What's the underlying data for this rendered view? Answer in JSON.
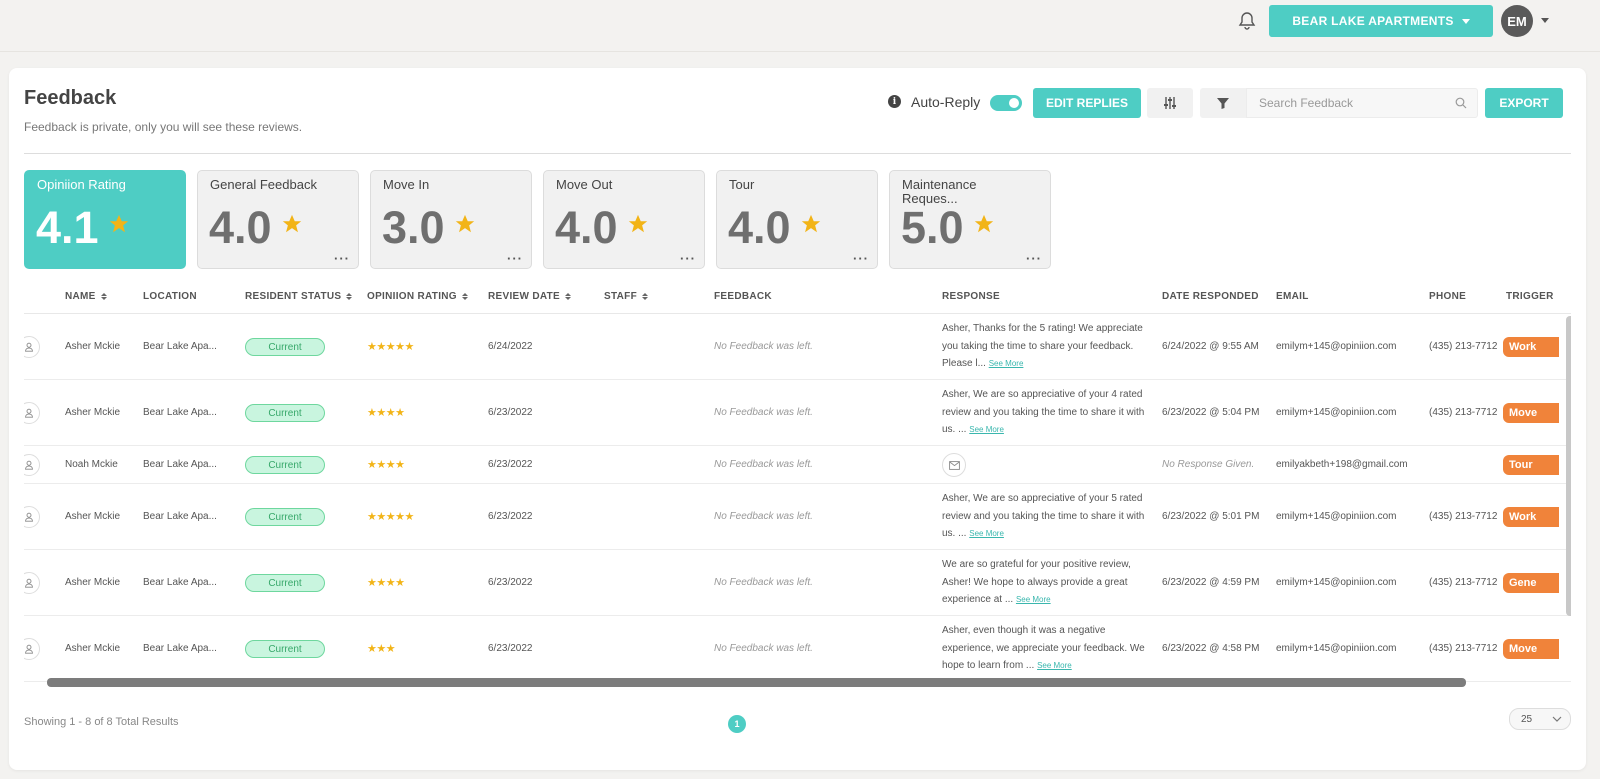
{
  "topbar": {
    "property_label": "BEAR LAKE APARTMENTS",
    "avatar_initials": "EM"
  },
  "page": {
    "title": "Feedback",
    "subtitle": "Feedback is private, only you will see these reviews."
  },
  "toolbar": {
    "auto_reply_label": "Auto-Reply",
    "auto_reply_on": true,
    "edit_replies_label": "EDIT REPLIES",
    "search_placeholder": "Search Feedback",
    "export_label": "EXPORT"
  },
  "rating_cards": [
    {
      "label": "Opiniion Rating",
      "value": "4.1",
      "active": true
    },
    {
      "label": "General Feedback",
      "value": "4.0"
    },
    {
      "label": "Move In",
      "value": "3.0"
    },
    {
      "label": "Move Out",
      "value": "4.0"
    },
    {
      "label": "Tour",
      "value": "4.0"
    },
    {
      "label": "Maintenance Reques...",
      "value": "5.0"
    }
  ],
  "table": {
    "columns": [
      "NAME",
      "LOCATION",
      "RESIDENT STATUS",
      "OPINIION RATING",
      "REVIEW DATE",
      "STAFF",
      "FEEDBACK",
      "RESPONSE",
      "DATE RESPONDED",
      "EMAIL",
      "PHONE",
      "TRIGGER"
    ],
    "see_more": "See More",
    "rows": [
      {
        "name": "Asher Mckie",
        "location": "Bear Lake Apa...",
        "status": "Current",
        "rating": 5,
        "review_date": "6/24/2022",
        "feedback": "No Feedback was left.",
        "response": "Asher, Thanks for the 5 rating! We appreciate you taking the time to share your feedback. Please l...",
        "date_responded": "6/24/2022 @ 9:55 AM",
        "email": "emilym+145@opiniion.com",
        "phone": "(435) 213-7712",
        "trigger": "Work"
      },
      {
        "name": "Asher Mckie",
        "location": "Bear Lake Apa...",
        "status": "Current",
        "rating": 4,
        "review_date": "6/23/2022",
        "feedback": "No Feedback was left.",
        "response": "Asher, We are so appreciative of your 4 rated review and you taking the time to share it with us. ...",
        "date_responded": "6/23/2022 @ 5:04 PM",
        "email": "emilym+145@opiniion.com",
        "phone": "(435) 213-7712",
        "trigger": "Move"
      },
      {
        "name": "Noah Mckie",
        "location": "Bear Lake Apa...",
        "status": "Current",
        "rating": 4,
        "review_date": "6/23/2022",
        "feedback": "No Feedback was left.",
        "response": "",
        "date_responded": "No Response Given.",
        "email": "emilyakbeth+198@gmail.com",
        "phone": "",
        "trigger": "Tour"
      },
      {
        "name": "Asher Mckie",
        "location": "Bear Lake Apa...",
        "status": "Current",
        "rating": 5,
        "review_date": "6/23/2022",
        "feedback": "No Feedback was left.",
        "response": "Asher, We are so appreciative of your 5 rated review and you taking the time to share it with us. ...",
        "date_responded": "6/23/2022 @ 5:01 PM",
        "email": "emilym+145@opiniion.com",
        "phone": "(435) 213-7712",
        "trigger": "Work"
      },
      {
        "name": "Asher Mckie",
        "location": "Bear Lake Apa...",
        "status": "Current",
        "rating": 4,
        "review_date": "6/23/2022",
        "feedback": "No Feedback was left.",
        "response": "We are so grateful for your positive review, Asher! We hope to always provide a great experience at ...",
        "date_responded": "6/23/2022 @ 4:59 PM",
        "email": "emilym+145@opiniion.com",
        "phone": "(435) 213-7712",
        "trigger": "Gene"
      },
      {
        "name": "Asher Mckie",
        "location": "Bear Lake Apa...",
        "status": "Current",
        "rating": 3,
        "review_date": "6/23/2022",
        "feedback": "No Feedback was left.",
        "response": "Asher, even though it was a negative experience, we appreciate your feedback. We hope to learn from ...",
        "date_responded": "6/23/2022 @ 4:58 PM",
        "email": "emilym+145@opiniion.com",
        "phone": "(435) 213-7712",
        "trigger": "Move"
      }
    ]
  },
  "footer": {
    "showing": "Showing 1 - 8 of 8 Total Results",
    "current_page": "1",
    "page_size": "25"
  },
  "colors": {
    "accent": "#4ecdc4",
    "trigger": "#f0833a",
    "star": "#f2b417",
    "status_bg": "#c9f5df"
  }
}
